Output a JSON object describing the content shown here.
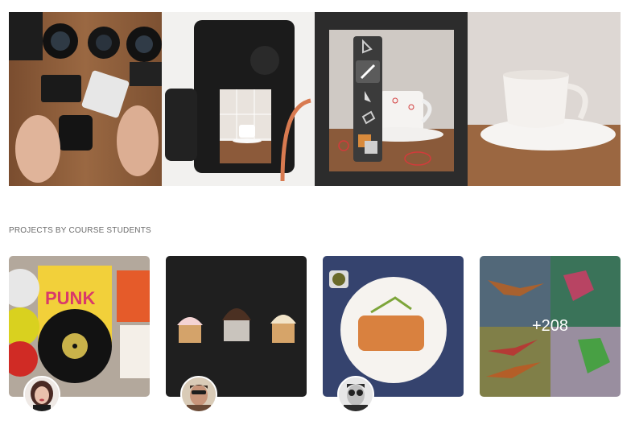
{
  "hero": {
    "images": [
      {
        "name": "camera-gear-on-table-image"
      },
      {
        "name": "camera-live-view-image"
      },
      {
        "name": "photo-editing-tools-image"
      },
      {
        "name": "coffee-cup-image"
      }
    ]
  },
  "projects": {
    "section_title": "PROJECTS BY COURSE STUDENTS",
    "cards": [
      {
        "name": "project-card-records",
        "avatar": "avatar-woman"
      },
      {
        "name": "project-card-cupcakes",
        "avatar": "avatar-man-sunglasses"
      },
      {
        "name": "project-card-salmon-plate",
        "avatar": "avatar-man-glasses"
      },
      {
        "name": "project-card-origami"
      }
    ],
    "more_count": "+208"
  },
  "colors": {
    "wood": "#8a5a37",
    "dark": "#2b2b2b",
    "navy": "#3d4c77"
  }
}
